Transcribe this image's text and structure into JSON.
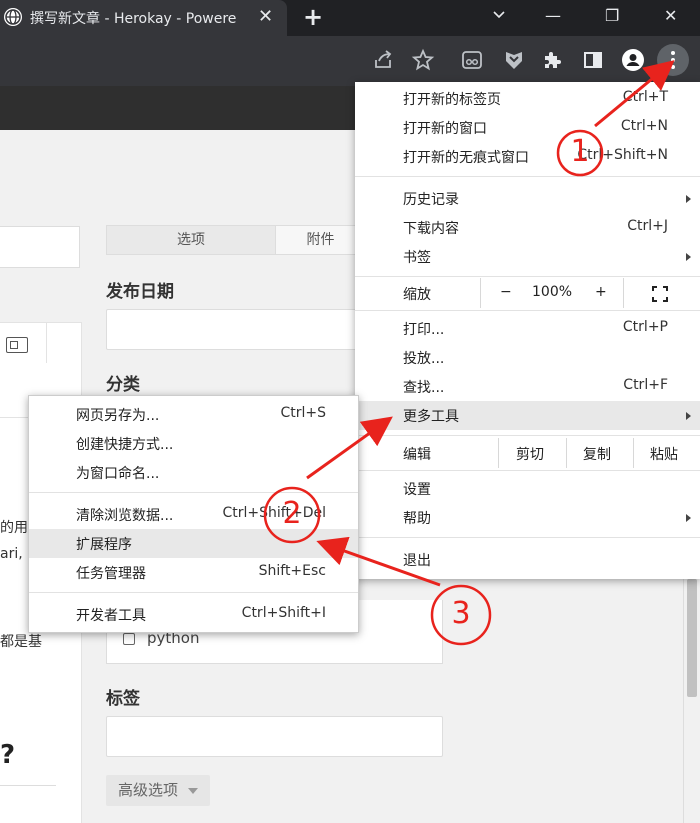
{
  "browser": {
    "tab_title": "撰写新文章 - Herokay - Powere",
    "tab_close": "✕",
    "new_tab": "+",
    "window_controls": {
      "minimize": "—",
      "maximize": "❐",
      "close": "✕"
    }
  },
  "page": {
    "tabs": [
      "选项",
      "附件"
    ],
    "publish_date_label": "发布日期",
    "category_label": "分类",
    "category_checkbox_label": "python",
    "tags_label": "标签",
    "advanced_button": "高级选项",
    "left_fragments": [
      "的用",
      "ari,",
      "都是基",
      "?"
    ]
  },
  "main_menu": {
    "items": [
      {
        "label": "打开新的标签页",
        "shortcut": "Ctrl+T"
      },
      {
        "label": "打开新的窗口",
        "shortcut": "Ctrl+N"
      },
      {
        "label": "打开新的无痕式窗口",
        "shortcut": "Ctrl+Shift+N"
      },
      {
        "label": "历史记录",
        "shortcut": ""
      },
      {
        "label": "下载内容",
        "shortcut": "Ctrl+J"
      },
      {
        "label": "书签",
        "shortcut": ""
      },
      {
        "label": "打印...",
        "shortcut": "Ctrl+P"
      },
      {
        "label": "投放...",
        "shortcut": ""
      },
      {
        "label": "查找...",
        "shortcut": "Ctrl+F"
      },
      {
        "label": "更多工具",
        "shortcut": ""
      },
      {
        "label": "设置",
        "shortcut": ""
      },
      {
        "label": "帮助",
        "shortcut": ""
      },
      {
        "label": "退出",
        "shortcut": ""
      }
    ],
    "zoom": {
      "label": "缩放",
      "minus": "−",
      "value": "100%",
      "plus": "+"
    },
    "edit": {
      "label": "编辑",
      "cut": "剪切",
      "copy": "复制",
      "paste": "粘贴"
    }
  },
  "more_tools_menu": {
    "items": [
      {
        "label": "网页另存为...",
        "shortcut": "Ctrl+S"
      },
      {
        "label": "创建快捷方式...",
        "shortcut": ""
      },
      {
        "label": "为窗口命名...",
        "shortcut": ""
      },
      {
        "label": "清除浏览数据...",
        "shortcut": "Ctrl+Shift+Del"
      },
      {
        "label": "扩展程序",
        "shortcut": ""
      },
      {
        "label": "任务管理器",
        "shortcut": "Shift+Esc"
      },
      {
        "label": "开发者工具",
        "shortcut": "Ctrl+Shift+I"
      }
    ]
  },
  "annotations": {
    "step1": "1",
    "step2": "2",
    "step3": "3",
    "color": "#e8231d"
  }
}
